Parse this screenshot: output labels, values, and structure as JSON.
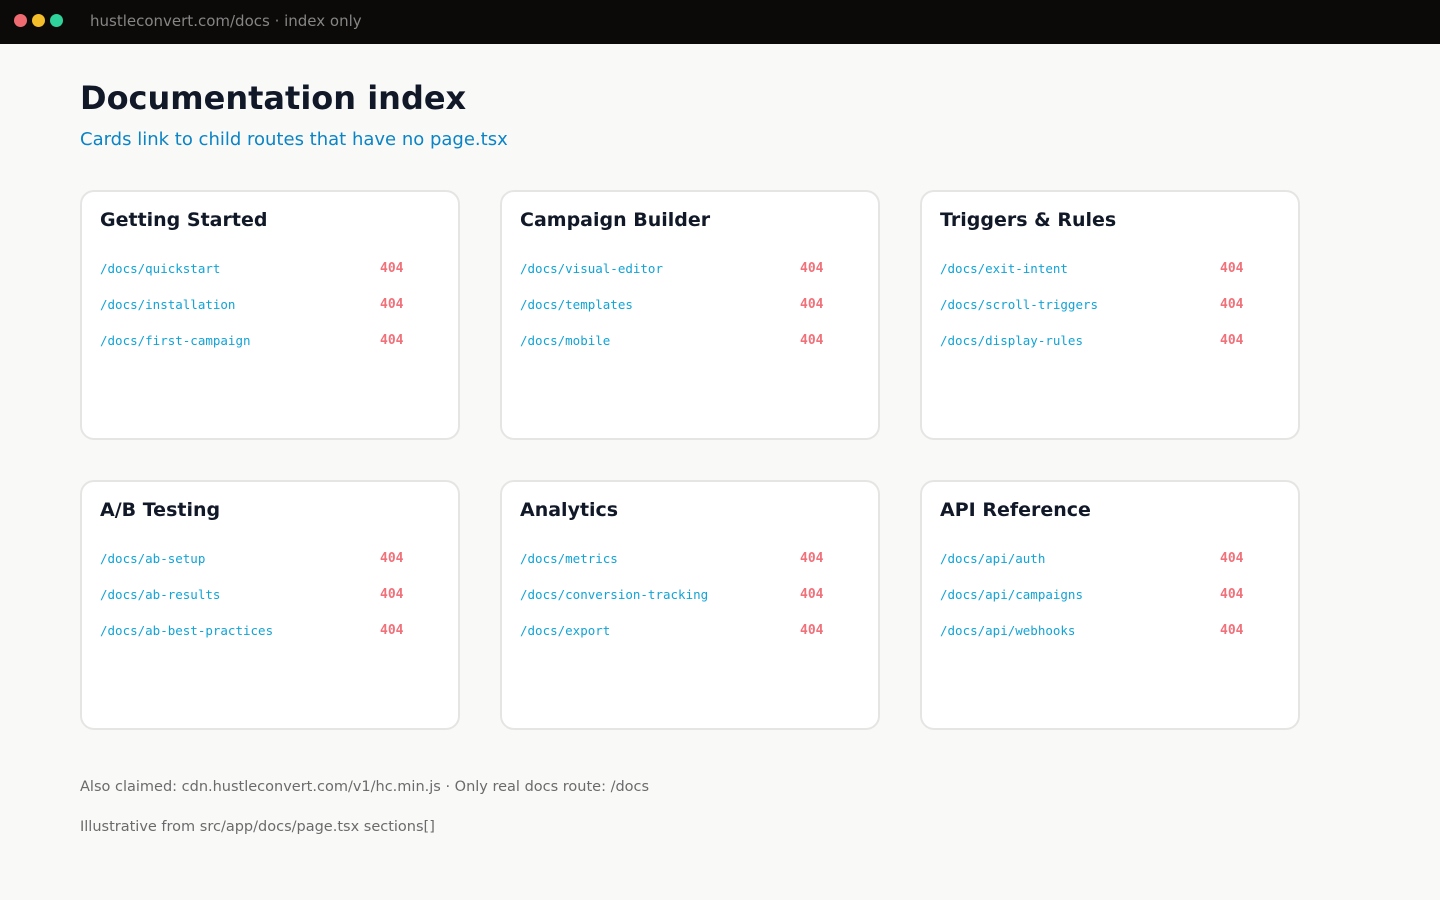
{
  "browser": {
    "url": "hustleconvert.com/docs · index only",
    "colors": {
      "close": "#f06a72",
      "minimize": "#f4bd2a",
      "maximize": "#2fd29a"
    }
  },
  "page": {
    "title": "Documentation index",
    "subtitle": "Cards link to child routes that have no page.tsx"
  },
  "cards": [
    {
      "title": "Getting Started",
      "routes": [
        {
          "path": "/docs/quickstart",
          "status": "404"
        },
        {
          "path": "/docs/installation",
          "status": "404"
        },
        {
          "path": "/docs/first-campaign",
          "status": "404"
        }
      ]
    },
    {
      "title": "Campaign Builder",
      "routes": [
        {
          "path": "/docs/visual-editor",
          "status": "404"
        },
        {
          "path": "/docs/templates",
          "status": "404"
        },
        {
          "path": "/docs/mobile",
          "status": "404"
        }
      ]
    },
    {
      "title": "Triggers & Rules",
      "routes": [
        {
          "path": "/docs/exit-intent",
          "status": "404"
        },
        {
          "path": "/docs/scroll-triggers",
          "status": "404"
        },
        {
          "path": "/docs/display-rules",
          "status": "404"
        }
      ]
    },
    {
      "title": "A/B Testing",
      "routes": [
        {
          "path": "/docs/ab-setup",
          "status": "404"
        },
        {
          "path": "/docs/ab-results",
          "status": "404"
        },
        {
          "path": "/docs/ab-best-practices",
          "status": "404"
        }
      ]
    },
    {
      "title": "Analytics",
      "routes": [
        {
          "path": "/docs/metrics",
          "status": "404"
        },
        {
          "path": "/docs/conversion-tracking",
          "status": "404"
        },
        {
          "path": "/docs/export",
          "status": "404"
        }
      ]
    },
    {
      "title": "API Reference",
      "routes": [
        {
          "path": "/docs/api/auth",
          "status": "404"
        },
        {
          "path": "/docs/api/campaigns",
          "status": "404"
        },
        {
          "path": "/docs/api/webhooks",
          "status": "404"
        }
      ]
    }
  ],
  "footer": {
    "claims": "Also claimed: cdn.hustleconvert.com/v1/hc.min.js  ·  Only real docs route: /docs",
    "source": "Illustrative from src/app/docs/page.tsx sections[]"
  },
  "colors": {
    "background": "#f9f9f8",
    "subtitle": "#0b84c6",
    "route_link": "#12a3d6",
    "status_404": "#f0717a"
  }
}
